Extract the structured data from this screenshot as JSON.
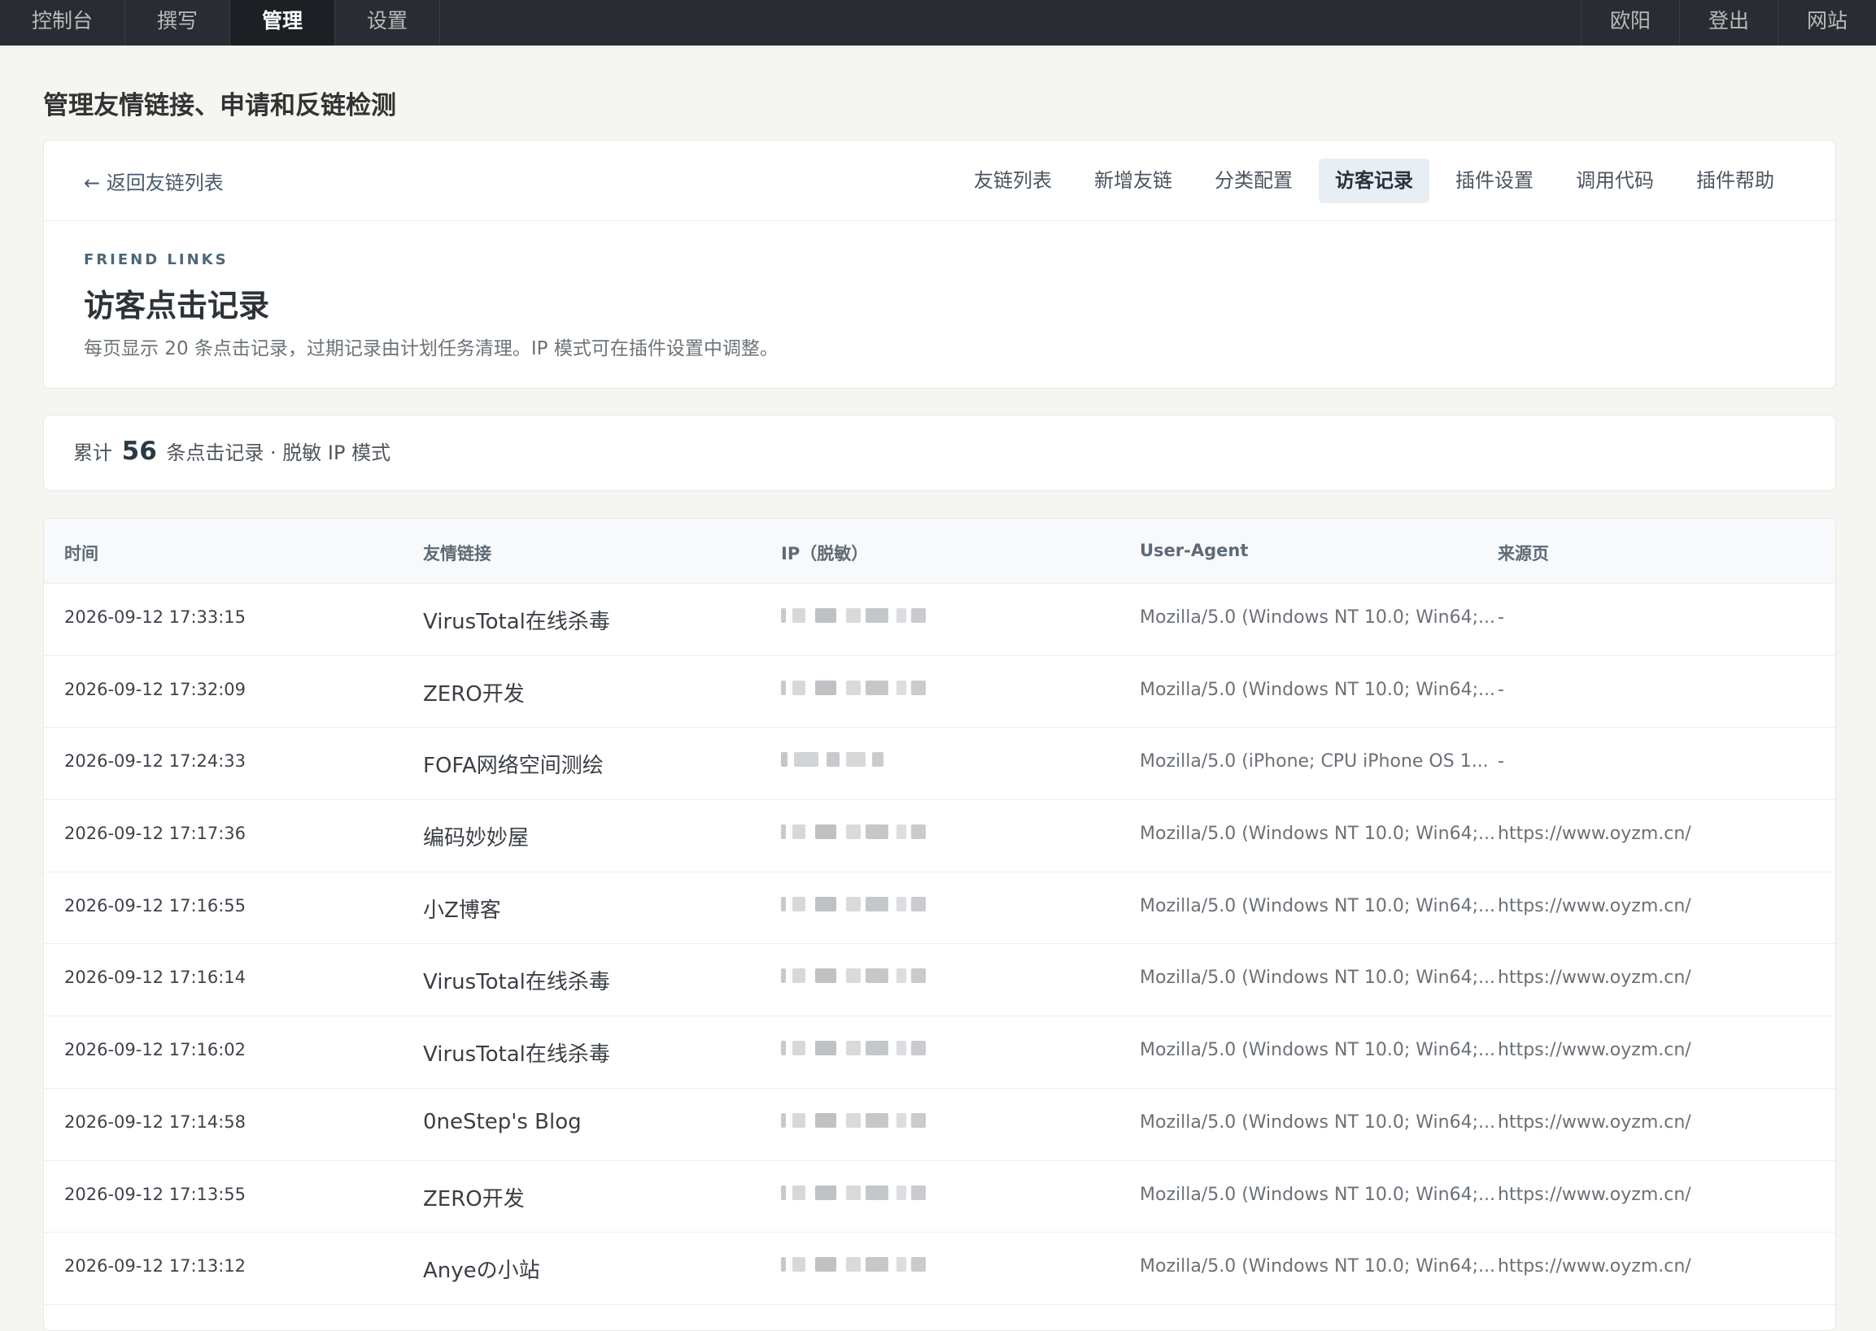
{
  "topbar": {
    "left": [
      "控制台",
      "撰写",
      "管理",
      "设置"
    ],
    "right": [
      "欧阳",
      "登出",
      "网站"
    ]
  },
  "page_heading": "管理友情链接、申请和反链检测",
  "subnav": {
    "back": "← 返回友链列表",
    "tabs": [
      "友链列表",
      "新增友链",
      "分类配置",
      "访客记录",
      "插件设置",
      "调用代码",
      "插件帮助"
    ]
  },
  "section": {
    "eyebrow": "FRIEND LINKS",
    "title": "访客点击记录",
    "desc": "每页显示 20 条点击记录，过期记录由计划任务清理。IP 模式可在插件设置中调整。"
  },
  "summary": {
    "prefix": "累计",
    "count": "56",
    "suffix": "条点击记录 · 脱敏 IP 模式"
  },
  "table": {
    "headers": [
      "时间",
      "友情链接",
      "IP（脱敏）",
      "User-Agent",
      "来源页"
    ],
    "rows": [
      {
        "time": "2026-09-12 17:33:15",
        "link": "VirusTotal在线杀毒",
        "ua": "Mozilla/5.0 (Windows NT 10.0; Win64;...",
        "ref": "-"
      },
      {
        "time": "2026-09-12 17:32:09",
        "link": "ZERO开发",
        "ua": "Mozilla/5.0 (Windows NT 10.0; Win64;...",
        "ref": "-"
      },
      {
        "time": "2026-09-12 17:24:33",
        "link": "FOFA网络空间测绘",
        "ua": "Mozilla/5.0 (iPhone; CPU iPhone OS 1...",
        "ref": "-"
      },
      {
        "time": "2026-09-12 17:17:36",
        "link": "编码妙妙屋",
        "ua": "Mozilla/5.0 (Windows NT 10.0; Win64;...",
        "ref": "https://www.oyzm.cn/"
      },
      {
        "time": "2026-09-12 17:16:55",
        "link": "小Z博客",
        "ua": "Mozilla/5.0 (Windows NT 10.0; Win64;...",
        "ref": "https://www.oyzm.cn/"
      },
      {
        "time": "2026-09-12 17:16:14",
        "link": "VirusTotal在线杀毒",
        "ua": "Mozilla/5.0 (Windows NT 10.0; Win64;...",
        "ref": "https://www.oyzm.cn/"
      },
      {
        "time": "2026-09-12 17:16:02",
        "link": "VirusTotal在线杀毒",
        "ua": "Mozilla/5.0 (Windows NT 10.0; Win64;...",
        "ref": "https://www.oyzm.cn/"
      },
      {
        "time": "2026-09-12 17:14:58",
        "link": "0neStep's Blog",
        "ua": "Mozilla/5.0 (Windows NT 10.0; Win64;...",
        "ref": "https://www.oyzm.cn/"
      },
      {
        "time": "2026-09-12 17:13:55",
        "link": "ZERO开发",
        "ua": "Mozilla/5.0 (Windows NT 10.0; Win64;...",
        "ref": "https://www.oyzm.cn/"
      },
      {
        "time": "2026-09-12 17:13:12",
        "link": "Anyeの小站",
        "ua": "Mozilla/5.0 (Windows NT 10.0; Win64;...",
        "ref": "https://www.oyzm.cn/"
      }
    ]
  },
  "colors": {
    "topbar_bg": "#292d33",
    "active_tab_bg": "#e8eef3",
    "page_bg": "#f5f5f1"
  }
}
